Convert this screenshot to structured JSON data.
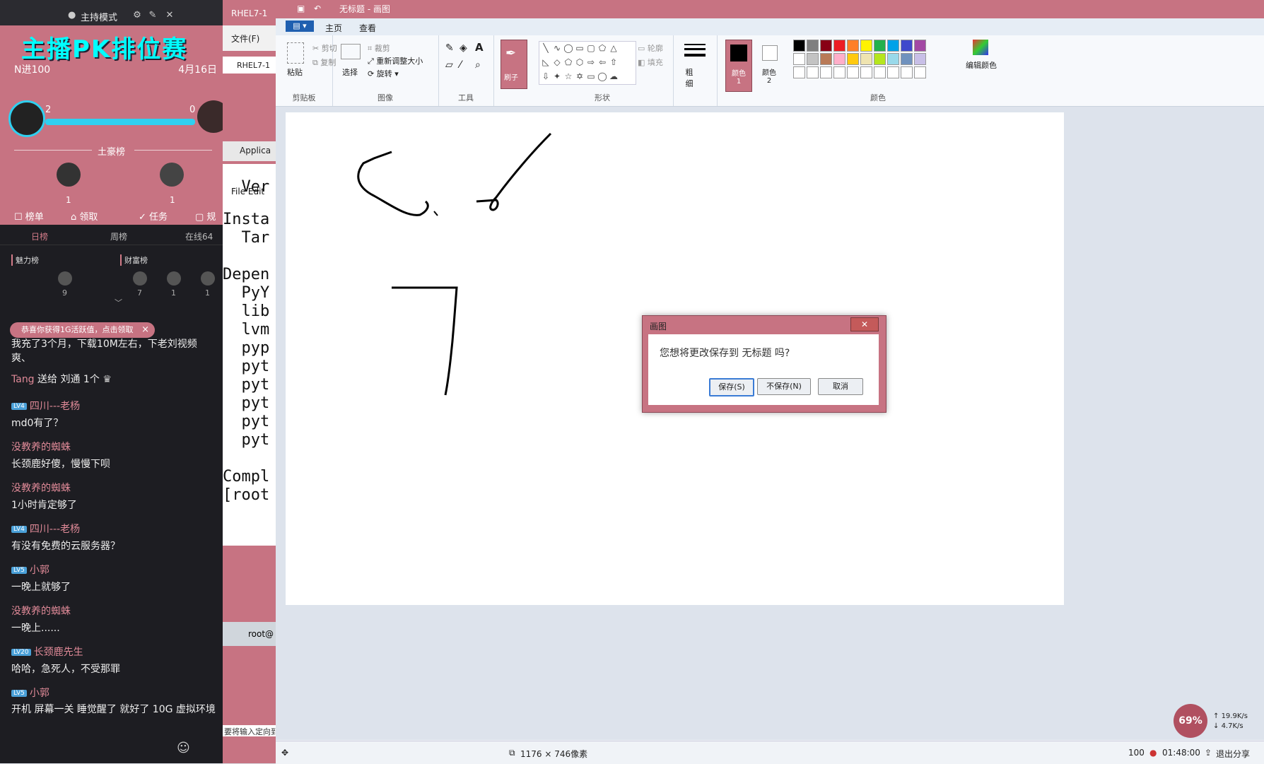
{
  "stream": {
    "mode_label": "主持模式",
    "banner": "主播PK排位赛",
    "round": "N进100",
    "date": "4月16日",
    "score_left": "2",
    "score_right": "0",
    "top_list": "土豪榜",
    "count_left": "1",
    "count_right": "1",
    "tabs": [
      "榜单",
      "领取",
      "任务",
      "规"
    ],
    "subtabs": [
      "日榜",
      "周榜",
      "在线64"
    ],
    "charm_label": "魅力榜",
    "wealth_label": "财富榜",
    "rank_counts": [
      "9",
      "7",
      "1",
      "1"
    ],
    "toast": "恭喜你获得1G活跃值，点击领取",
    "toast_close": "×",
    "messages": [
      {
        "name": "",
        "text": "我充了3个月，下载10M左右，下老刘视频爽、",
        "badge": ""
      },
      {
        "name": "Tang",
        "text": "送给 刘通 1个",
        "badge": ""
      },
      {
        "name": "四川---老杨",
        "text": "md0有了？",
        "badge": "LV4"
      },
      {
        "name": "没教养的蜘蛛",
        "text": "长颈鹿好傻，慢慢下呗",
        "badge": ""
      },
      {
        "name": "没教养的蜘蛛",
        "text": "1小时肯定够了",
        "badge": ""
      },
      {
        "name": "四川---老杨",
        "text": "有没有免费的云服务器？",
        "badge": "LV4"
      },
      {
        "name": "小郭",
        "text": "一晚上就够了",
        "badge": "LV5"
      },
      {
        "name": "没教养的蜘蛛",
        "text": "一晚上......",
        "badge": ""
      },
      {
        "name": "长颈鹿先生",
        "text": "哈哈，急死人，不受那罪",
        "badge": "LV20"
      },
      {
        "name": "小郭",
        "text": "开机 屏幕一关 睡觉醒了 就好了 10G 虚拟环境",
        "badge": "LV5"
      }
    ]
  },
  "terminal": {
    "title": "RHEL7-1",
    "menu_file": "文件(F)",
    "tab": "RHEL7-1",
    "app_tab": "Applica",
    "menu": "File  Edit",
    "lines": [
      "  Ver",
      "",
      "Insta",
      "  Tar",
      "",
      "Depen",
      "  PyY",
      "  lib",
      "  lvm",
      "  pyp",
      "  pyt",
      "  pyt",
      "  pyt",
      "  pyt",
      "  pyt",
      "",
      "Compl",
      "[root"
    ],
    "rootbar": "root@",
    "footer": "要将输入定向到"
  },
  "paint": {
    "title": "无标题 - 画图",
    "tabs": [
      "主页",
      "查看"
    ],
    "clipboard": {
      "paste": "粘贴",
      "cut": "剪切",
      "copy": "复制",
      "label": "剪贴板"
    },
    "image": {
      "select": "选择",
      "crop": "裁剪",
      "resize": "重新调整大小",
      "rotate": "旋转",
      "label": "图像"
    },
    "tools": {
      "label": "工具"
    },
    "brush_label": "刷子",
    "shapes": {
      "outline": "轮廓",
      "fill": "填充",
      "label": "形状"
    },
    "size_label": "粗细",
    "color1": "颜色 1",
    "color2": "颜色 2",
    "colors_label": "颜色",
    "edit_colors": "编辑颜色",
    "status": {
      "dimensions": "1176 × 746像素",
      "zoom": "100"
    },
    "palette": [
      "#000000",
      "#7f7f7f",
      "#880015",
      "#ed1c24",
      "#ff7f27",
      "#fff200",
      "#22b14c",
      "#00a2e8",
      "#3f48cc",
      "#a349a4",
      "#ffffff",
      "#c3c3c3",
      "#b97a57",
      "#ffaec9",
      "#ffc90e",
      "#efe4b0",
      "#b5e61d",
      "#99d9ea",
      "#7092be",
      "#c8bfe7"
    ]
  },
  "dialog": {
    "title": "画图",
    "message": "您想将更改保存到 无标题 吗?",
    "save": "保存(S)",
    "dont_save": "不保存(N)",
    "cancel": "取消"
  },
  "system": {
    "net_percent": "69%",
    "up_speed": "19.9K/s",
    "down_speed": "4.7K/s",
    "timer": "01:48:00",
    "exit_share": "退出分享"
  }
}
